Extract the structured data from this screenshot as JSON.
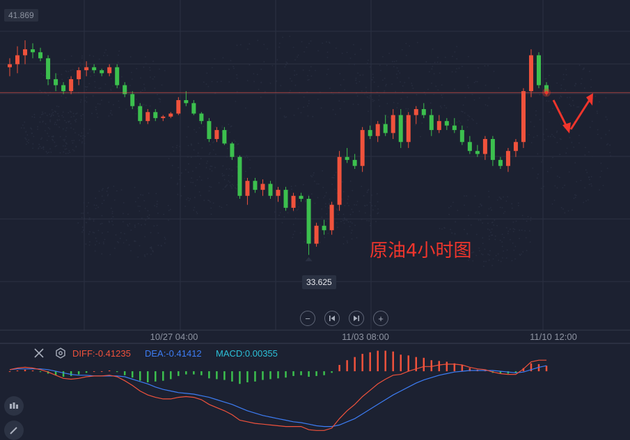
{
  "chart_data": {
    "type": "candlestick",
    "y_readout_top": "41.869",
    "low_label": "33.625",
    "annotation": "原油4小时图",
    "x_tick_labels": [
      "10/27 04:00",
      "11/03 08:00",
      "11/10 12:00"
    ],
    "price_line_value": 39.05,
    "ylim": [
      33.2,
      41.869
    ],
    "candles": [
      [
        39.9,
        40.2,
        39.6,
        40.0
      ],
      [
        40.0,
        40.6,
        39.7,
        40.3
      ],
      [
        40.3,
        40.8,
        40.0,
        40.5
      ],
      [
        40.5,
        40.7,
        40.2,
        40.4
      ],
      [
        40.4,
        40.55,
        40.1,
        40.2
      ],
      [
        40.2,
        40.3,
        39.3,
        39.5
      ],
      [
        39.5,
        39.7,
        39.1,
        39.3
      ],
      [
        39.3,
        39.4,
        39.0,
        39.1
      ],
      [
        39.1,
        39.6,
        39.0,
        39.5
      ],
      [
        39.5,
        39.9,
        39.3,
        39.8
      ],
      [
        39.8,
        40.1,
        39.6,
        39.9
      ],
      [
        39.9,
        40.0,
        39.7,
        39.8
      ],
      [
        39.8,
        39.85,
        39.6,
        39.7
      ],
      [
        39.7,
        40.0,
        39.6,
        39.9
      ],
      [
        39.9,
        40.0,
        39.2,
        39.3
      ],
      [
        39.3,
        39.4,
        38.9,
        39.0
      ],
      [
        39.0,
        39.1,
        38.5,
        38.6
      ],
      [
        38.6,
        38.7,
        38.0,
        38.1
      ],
      [
        38.1,
        38.5,
        38.0,
        38.4
      ],
      [
        38.4,
        38.5,
        38.1,
        38.2
      ],
      [
        38.2,
        38.3,
        38.1,
        38.25
      ],
      [
        38.25,
        38.4,
        38.2,
        38.35
      ],
      [
        38.35,
        38.9,
        38.3,
        38.8
      ],
      [
        38.8,
        39.1,
        38.6,
        38.7
      ],
      [
        38.7,
        38.8,
        38.3,
        38.35
      ],
      [
        38.35,
        38.4,
        38.0,
        38.1
      ],
      [
        38.1,
        38.2,
        37.4,
        37.5
      ],
      [
        37.5,
        37.9,
        37.4,
        37.8
      ],
      [
        37.8,
        37.9,
        37.3,
        37.35
      ],
      [
        37.35,
        37.4,
        36.8,
        36.9
      ],
      [
        36.9,
        36.95,
        35.5,
        35.6
      ],
      [
        35.6,
        36.2,
        35.3,
        36.1
      ],
      [
        36.1,
        36.2,
        35.7,
        35.8
      ],
      [
        35.8,
        36.15,
        35.6,
        36.0
      ],
      [
        36.0,
        36.1,
        35.5,
        35.6
      ],
      [
        35.6,
        35.9,
        35.4,
        35.8
      ],
      [
        35.8,
        35.9,
        35.1,
        35.2
      ],
      [
        35.2,
        35.7,
        35.1,
        35.6
      ],
      [
        35.6,
        35.7,
        35.4,
        35.5
      ],
      [
        35.5,
        35.6,
        33.625,
        34.0
      ],
      [
        34.0,
        34.7,
        33.9,
        34.6
      ],
      [
        34.6,
        34.8,
        34.3,
        34.45
      ],
      [
        34.45,
        35.4,
        34.3,
        35.3
      ],
      [
        35.3,
        37.1,
        35.1,
        36.9
      ],
      [
        36.9,
        37.2,
        36.7,
        36.8
      ],
      [
        36.8,
        37.0,
        36.5,
        36.6
      ],
      [
        36.6,
        37.9,
        36.4,
        37.8
      ],
      [
        37.8,
        37.95,
        37.5,
        37.6
      ],
      [
        37.6,
        38.1,
        37.4,
        38.0
      ],
      [
        38.0,
        38.3,
        37.6,
        37.7
      ],
      [
        37.7,
        38.5,
        37.5,
        38.3
      ],
      [
        38.3,
        38.5,
        37.2,
        37.4
      ],
      [
        37.4,
        38.4,
        37.2,
        38.3
      ],
      [
        38.3,
        38.6,
        38.0,
        38.5
      ],
      [
        38.5,
        38.7,
        38.2,
        38.3
      ],
      [
        38.3,
        38.5,
        37.6,
        37.8
      ],
      [
        37.8,
        38.3,
        37.7,
        38.1
      ],
      [
        38.1,
        38.2,
        37.8,
        37.95
      ],
      [
        37.95,
        38.2,
        37.7,
        37.8
      ],
      [
        37.8,
        37.95,
        37.3,
        37.4
      ],
      [
        37.4,
        37.6,
        37.0,
        37.1
      ],
      [
        37.1,
        37.3,
        36.9,
        37.0
      ],
      [
        37.0,
        37.6,
        36.8,
        37.5
      ],
      [
        37.5,
        37.6,
        36.6,
        36.8
      ],
      [
        36.8,
        36.9,
        36.5,
        36.6
      ],
      [
        36.6,
        37.2,
        36.4,
        37.1
      ],
      [
        37.1,
        37.5,
        36.9,
        37.4
      ],
      [
        37.4,
        39.2,
        37.2,
        39.1
      ],
      [
        39.1,
        40.5,
        38.9,
        40.3
      ],
      [
        40.3,
        40.4,
        39.2,
        39.3
      ],
      [
        39.3,
        39.4,
        38.95,
        39.05
      ]
    ],
    "macd": {
      "diff_label": "DIFF:-0.41235",
      "dea_label": "DEA:-0.41412",
      "macd_label": "MACD:0.00355",
      "diff_color": "#f0523c",
      "dea_color": "#3d7df5",
      "macd_color": "#2cc0d8",
      "range": [
        -0.8,
        0.3
      ],
      "diff": [
        0.02,
        0.04,
        0.05,
        0.04,
        0.02,
        -0.01,
        -0.05,
        -0.09,
        -0.1,
        -0.09,
        -0.07,
        -0.06,
        -0.06,
        -0.05,
        -0.07,
        -0.12,
        -0.18,
        -0.25,
        -0.3,
        -0.33,
        -0.35,
        -0.35,
        -0.33,
        -0.32,
        -0.33,
        -0.36,
        -0.42,
        -0.46,
        -0.5,
        -0.55,
        -0.62,
        -0.64,
        -0.66,
        -0.67,
        -0.68,
        -0.69,
        -0.7,
        -0.7,
        -0.7,
        -0.74,
        -0.75,
        -0.75,
        -0.72,
        -0.6,
        -0.5,
        -0.42,
        -0.32,
        -0.24,
        -0.16,
        -0.1,
        -0.05,
        -0.04,
        0.0,
        0.03,
        0.06,
        0.06,
        0.08,
        0.09,
        0.09,
        0.08,
        0.05,
        0.03,
        0.02,
        -0.01,
        -0.03,
        -0.04,
        -0.04,
        0.03,
        0.12,
        0.14,
        0.14
      ],
      "dea": [
        0.02,
        0.03,
        0.03,
        0.03,
        0.03,
        0.02,
        0.0,
        -0.02,
        -0.04,
        -0.05,
        -0.05,
        -0.06,
        -0.06,
        -0.06,
        -0.06,
        -0.07,
        -0.1,
        -0.13,
        -0.16,
        -0.2,
        -0.23,
        -0.25,
        -0.27,
        -0.28,
        -0.29,
        -0.31,
        -0.33,
        -0.36,
        -0.39,
        -0.42,
        -0.46,
        -0.5,
        -0.53,
        -0.56,
        -0.58,
        -0.6,
        -0.62,
        -0.64,
        -0.65,
        -0.67,
        -0.69,
        -0.7,
        -0.7,
        -0.68,
        -0.64,
        -0.6,
        -0.54,
        -0.48,
        -0.42,
        -0.36,
        -0.3,
        -0.25,
        -0.2,
        -0.15,
        -0.11,
        -0.08,
        -0.05,
        -0.03,
        -0.01,
        0.0,
        0.01,
        0.01,
        0.01,
        0.01,
        0.0,
        -0.01,
        -0.02,
        -0.01,
        0.02,
        0.05,
        0.07
      ],
      "hist": [
        0.0,
        0.01,
        0.02,
        0.01,
        -0.01,
        -0.03,
        -0.05,
        -0.07,
        -0.06,
        -0.04,
        -0.02,
        0.0,
        0.0,
        0.01,
        -0.01,
        -0.05,
        -0.08,
        -0.12,
        -0.14,
        -0.13,
        -0.12,
        -0.1,
        -0.06,
        -0.04,
        -0.04,
        -0.05,
        -0.09,
        -0.1,
        -0.11,
        -0.13,
        -0.16,
        -0.14,
        -0.13,
        -0.11,
        -0.1,
        -0.09,
        -0.08,
        -0.06,
        -0.05,
        -0.07,
        -0.06,
        -0.05,
        -0.02,
        0.08,
        0.14,
        0.18,
        0.22,
        0.24,
        0.26,
        0.26,
        0.25,
        0.21,
        0.2,
        0.18,
        0.17,
        0.14,
        0.13,
        0.12,
        0.1,
        0.08,
        0.04,
        0.02,
        0.01,
        -0.02,
        -0.03,
        -0.03,
        -0.02,
        0.04,
        0.1,
        0.09,
        0.07
      ]
    }
  },
  "colors": {
    "up": "#f0523c",
    "down": "#3cc04e",
    "background": "#1c2131",
    "grid": "#2b3143",
    "axis_text": "#8d93a1",
    "annotation": "#f0352c",
    "price_line": "#e0524a"
  },
  "controls": {
    "zoom_out_icon": "minus-icon",
    "prev_icon": "skip-back-icon",
    "next_icon": "skip-forward-icon",
    "zoom_in_icon": "plus-icon",
    "close_icon": "close-icon",
    "settings_icon": "settings-icon"
  }
}
